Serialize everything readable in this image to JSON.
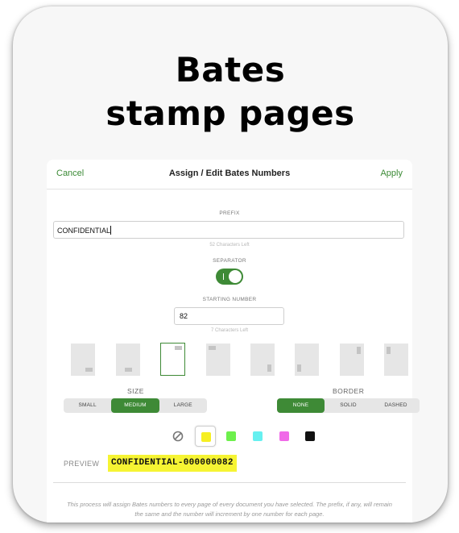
{
  "headline": {
    "line1": "Bates",
    "line2": "stamp pages"
  },
  "navbar": {
    "cancel_label": "Cancel",
    "title": "Assign / Edit Bates Numbers",
    "apply_label": "Apply"
  },
  "prefix": {
    "label": "PREFIX",
    "value": "CONFIDENTIAL",
    "hint": "52 Characters Left"
  },
  "separator": {
    "label": "SEPARATOR",
    "enabled": true
  },
  "starting_number": {
    "label": "STARTING NUMBER",
    "value": "82",
    "hint": "7 Characters Left"
  },
  "positions": {
    "selected_index": 2,
    "count": 8
  },
  "size": {
    "label": "SIZE",
    "options": [
      "SMALL",
      "MEDIUM",
      "LARGE"
    ],
    "selected": "MEDIUM"
  },
  "border": {
    "label": "BORDER",
    "options": [
      "NONE",
      "SOLID",
      "DASHED"
    ],
    "selected": "NONE"
  },
  "colors": {
    "none_icon": "no-color-icon",
    "swatches": [
      "#f6ef22",
      "#6df04c",
      "#66f0f0",
      "#f06ae8",
      "#111111"
    ],
    "selected_index": 0
  },
  "preview": {
    "label": "PREVIEW",
    "text": "CONFIDENTIAL-000000082"
  },
  "note": "This process will assign Bates numbers to every page of every document you have selected. The prefix, if any, will remain the same and the number will increment by one number for each page.",
  "accent_color": "#3e8a36"
}
